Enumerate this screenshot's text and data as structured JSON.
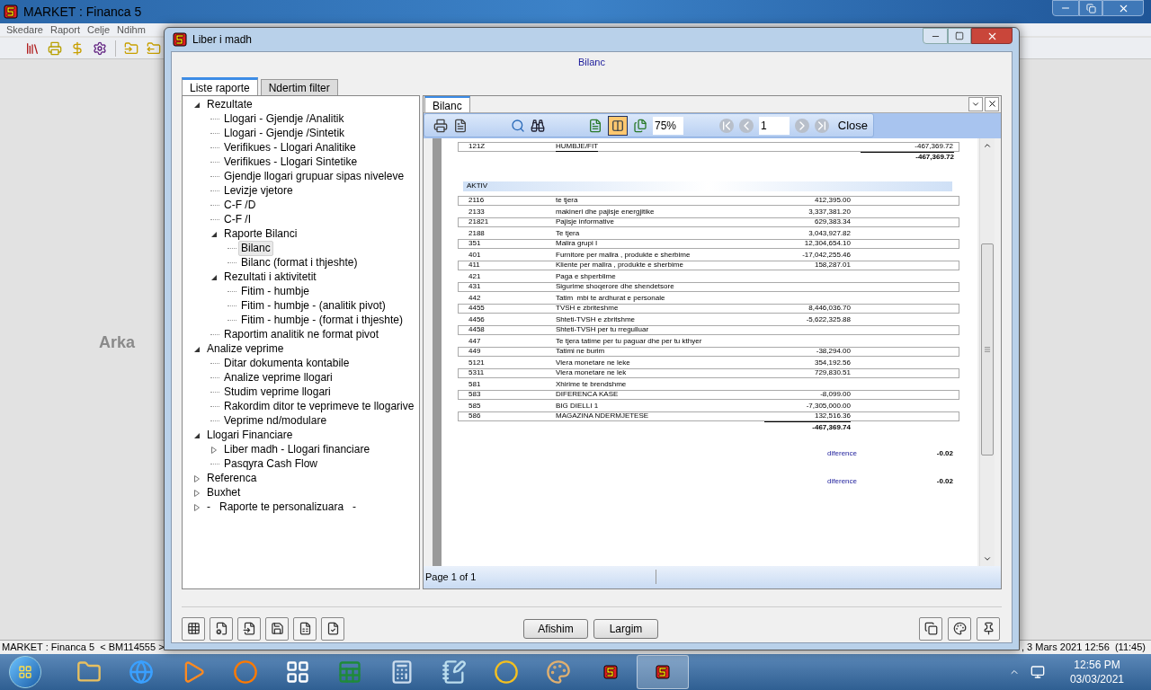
{
  "app": {
    "title": "MARKET : Financa 5",
    "menu": [
      "Skedare",
      "Raport",
      "Celje",
      "Ndihm"
    ],
    "background_label": "Arka",
    "status_left": "MARKET : Financa 5  < BM114555 >",
    "status_right": ", 3 Mars 2021 12:56  (11:45)"
  },
  "dialog": {
    "title": "Liber i madh",
    "heading": "Bilanc",
    "tabs": [
      {
        "label": "Liste raporte",
        "selected": true
      },
      {
        "label": "Ndertim filter",
        "selected": false
      }
    ],
    "tree": [
      {
        "label": "Rezultate",
        "selected": false,
        "expanded": true,
        "children": [
          {
            "label": "Llogari - Gjendje /Analitik",
            "selected": false
          },
          {
            "label": "Llogari - Gjendje /Sintetik",
            "selected": false
          },
          {
            "label": "Verifikues - Llogari Analitike",
            "selected": false
          },
          {
            "label": "Verifikues - Llogari Sintetike",
            "selected": false
          },
          {
            "label": "Gjendje llogari grupuar sipas niveleve",
            "selected": false
          },
          {
            "label": "Levizje vjetore",
            "selected": false
          },
          {
            "label": "C-F /D",
            "selected": false
          },
          {
            "label": "C-F /I",
            "selected": false
          },
          {
            "label": "Raporte Bilanci",
            "selected": false,
            "expanded": true,
            "children": [
              {
                "label": "Bilanc",
                "selected": true
              },
              {
                "label": "Bilanc (format i thjeshte)",
                "selected": false
              }
            ]
          },
          {
            "label": "Rezultati i aktivitetit",
            "selected": false,
            "expanded": true,
            "children": [
              {
                "label": "Fitim - humbje",
                "selected": false
              },
              {
                "label": "Fitim - humbje - (analitik pivot)",
                "selected": false
              },
              {
                "label": "Fitim - humbje - (format i thjeshte)",
                "selected": false
              }
            ]
          },
          {
            "label": "Raportim analitik ne format pivot",
            "selected": false
          }
        ]
      },
      {
        "label": "Analize veprime",
        "selected": false,
        "expanded": true,
        "children": [
          {
            "label": "Ditar dokumenta kontabile",
            "selected": false
          },
          {
            "label": "Analize veprime llogari",
            "selected": false
          },
          {
            "label": "Studim veprime llogari",
            "selected": false
          },
          {
            "label": "Rakordim ditor te veprimeve te llogarive",
            "selected": false
          },
          {
            "label": "Veprime nd/modulare",
            "selected": false
          }
        ]
      },
      {
        "label": "Llogari Financiare",
        "selected": false,
        "expanded": true,
        "children": [
          {
            "label": "Liber madh - Llogari financiare",
            "selected": false,
            "expanded": false
          },
          {
            "label": "Pasqyra Cash Flow",
            "selected": false
          }
        ]
      },
      {
        "label": "Referenca",
        "selected": false,
        "expanded": false
      },
      {
        "label": "Buxhet",
        "selected": false,
        "expanded": false
      },
      {
        "label": "-   Raporte te personalizuara   -",
        "selected": false,
        "expanded": false
      }
    ],
    "report": {
      "tab": "Bilanc",
      "zoom": "75%",
      "page_input": "1",
      "close": "Close",
      "page_status": "Page 1 of 1",
      "top_row": {
        "code": "121Z",
        "name": "HUMBJE/FIT",
        "amount": "-467,369.72"
      },
      "top_total": "-467,369.72",
      "section": "AKTIV",
      "rows": [
        {
          "code": "2116",
          "name": "te tjera",
          "amount": "412,395.00"
        },
        {
          "code": "2133",
          "name": "makineri dhe pajisje energjitike",
          "amount": "3,337,381.20"
        },
        {
          "code": "21821",
          "name": "Pajisje informative",
          "amount": "629,383.34"
        },
        {
          "code": "2188",
          "name": "Te tjera",
          "amount": "3,043,927.82"
        },
        {
          "code": "351",
          "name": "Malira grupi I",
          "amount": "12,304,654.10"
        },
        {
          "code": "401",
          "name": "Furnitore per mallra , produkte e sherbime",
          "amount": "-17,042,255.46"
        },
        {
          "code": "411",
          "name": "Kliente per mallra , produkte e sherbime",
          "amount": "158,287.01"
        },
        {
          "code": "421",
          "name": "Paga e shperblime"
        },
        {
          "code": "431",
          "name": "Sigurime shoqerore dhe shendetsore"
        },
        {
          "code": "442",
          "name": "Tatim  mbi te ardhurat e personale"
        },
        {
          "code": "4455",
          "name": "TVSH e zbriteshme",
          "amount": "8,446,036.70"
        },
        {
          "code": "4456",
          "name": "Shteti-TVSH e zbritshme",
          "amount": "-5,622,325.88"
        },
        {
          "code": "4458",
          "name": "Shteti-TVSH per tu rregulluar"
        },
        {
          "code": "447",
          "name": "Te tjera tatime per tu paguar dhe per tu kthyer"
        },
        {
          "code": "449",
          "name": "Tatimi ne burim",
          "amount": "-38,294.00"
        },
        {
          "code": "5121",
          "name": "Vlera monetare ne leke",
          "amount": "354,192.56"
        },
        {
          "code": "5311",
          "name": "Vlera monetare ne lek",
          "amount": "729,830.51"
        },
        {
          "code": "581",
          "name": "Xhirime te brendshme"
        },
        {
          "code": "583",
          "name": "DIFERENCA KASE",
          "amount": "-8,099.00"
        },
        {
          "code": "585",
          "name": "BIG DIELLI 1",
          "amount": "-7,305,000.00"
        },
        {
          "code": "586",
          "name": "MAGAZINA NDERMJETESE",
          "amount": "132,516.36"
        }
      ],
      "total": "-467,369.74",
      "differences": [
        {
          "label": "diference",
          "value": "-0.02"
        },
        {
          "label": "diference",
          "value": "-0.02"
        }
      ]
    },
    "buttons": [
      "Afishim",
      "Largim"
    ]
  },
  "taskbar": {
    "time": "12:56 PM",
    "date": "03/03/2021"
  }
}
